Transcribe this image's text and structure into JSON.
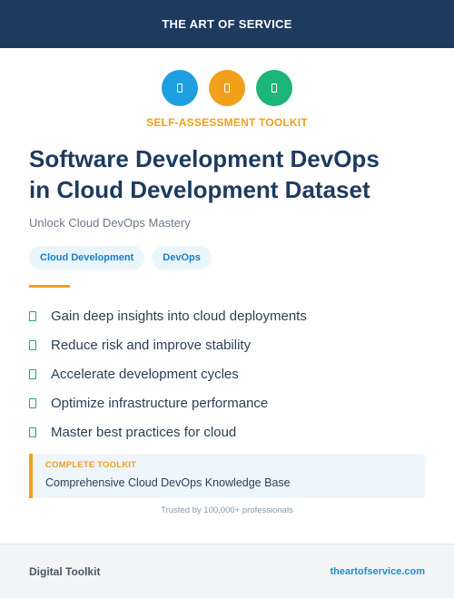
{
  "header": {
    "brand": "THE ART OF SERVICE"
  },
  "icons": [
    {
      "name": "blue-badge-icon",
      "color": "#1ea0e0"
    },
    {
      "name": "orange-badge-icon",
      "color": "#f0a01a"
    },
    {
      "name": "green-badge-icon",
      "color": "#1cb57a"
    }
  ],
  "hero": {
    "eyebrow": "SELF-ASSESSMENT TOOLKIT",
    "title_line1": "Software Development DevOps",
    "title_line2": "in Cloud Development Dataset",
    "subtitle": "Unlock Cloud DevOps Mastery"
  },
  "tags": [
    "Cloud Development",
    "DevOps"
  ],
  "benefits": [
    "Gain deep insights into cloud deployments",
    "Reduce risk and improve stability",
    "Accelerate development cycles",
    "Optimize infrastructure performance",
    "Master best practices for cloud"
  ],
  "callout": {
    "label": "COMPLETE TOOLKIT",
    "text": "Comprehensive Cloud DevOps Knowledge Base"
  },
  "trust": "Trusted by 100,000+ professionals",
  "footer": {
    "left": "Digital Toolkit",
    "link": "theartofservice.com"
  },
  "colors": {
    "navy": "#1e3a5f",
    "accent_orange": "#f0a01a",
    "check_green": "#1aaa6a",
    "link_blue": "#1b8fd0"
  }
}
